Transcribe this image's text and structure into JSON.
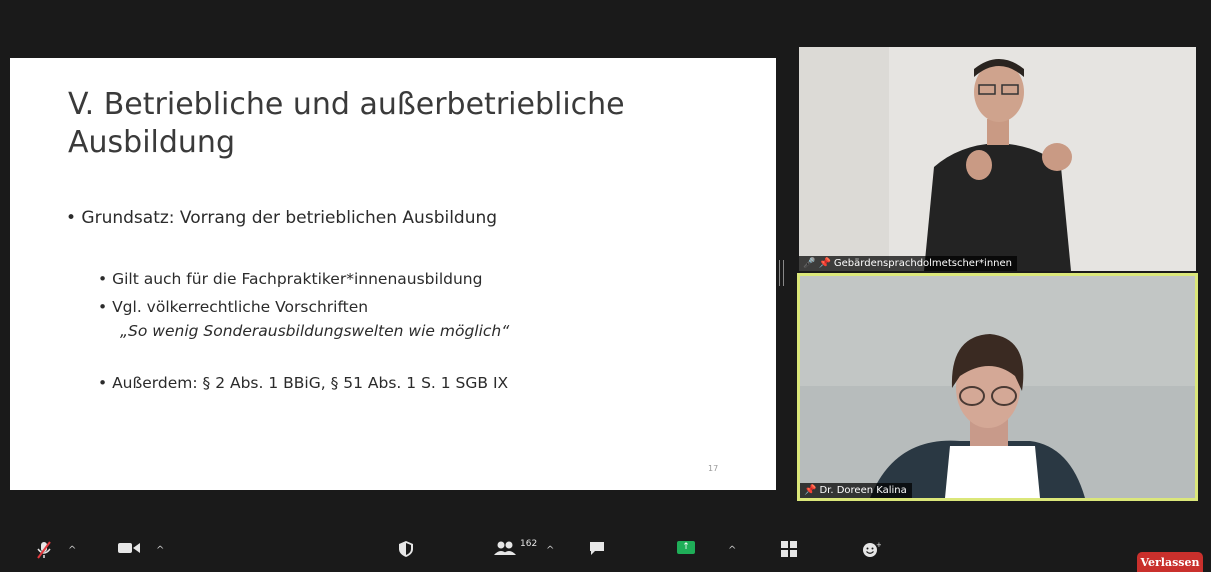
{
  "slide": {
    "title": "V. Betriebliche und außerbetriebliche Ausbildung",
    "bullets": {
      "main": "• Grundsatz: Vorrang der betrieblichen Ausbildung",
      "sub1": "• Gilt auch für die Fachpraktiker*innenausbildung",
      "sub2": "• Vgl. völkerrechtliche Vorschriften",
      "quote": "„So wenig Sonderausbildungswelten wie möglich“",
      "sub3": "• Außerdem: § 2 Abs. 1 BBiG, § 51 Abs. 1 S. 1 SGB IX"
    },
    "page_number": "17"
  },
  "participants": [
    {
      "name": "Gebärdensprachdolmetscher*innen"
    },
    {
      "name": "Dr. Doreen Kalina"
    }
  ],
  "toolbar": {
    "participants_count": "162",
    "leave_label": "Verlassen"
  },
  "colors": {
    "active_speaker_border": "#dbe77a",
    "leave_button": "#c9302c",
    "share_green": "#1fae58",
    "muted_red": "#e0393e"
  }
}
